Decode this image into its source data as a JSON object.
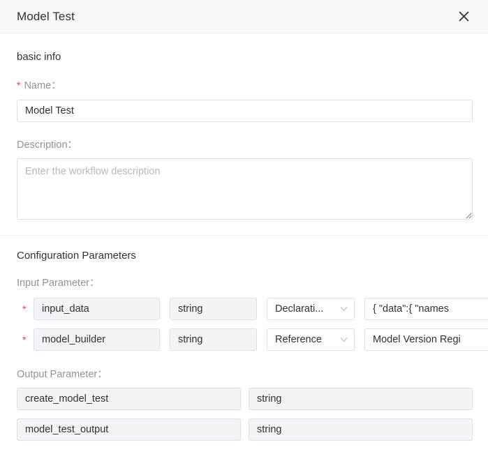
{
  "header": {
    "title": "Model Test",
    "close_label": "×"
  },
  "basic_info": {
    "section_title": "basic info",
    "name_label": "Name：",
    "name_required_mark": "*",
    "name_value": "Model Test",
    "description_label": "Description：",
    "description_value": "",
    "description_placeholder": "Enter the workflow description"
  },
  "configuration": {
    "section_title": "Configuration Parameters",
    "input_label": "Input Parameter：",
    "output_label": "Output Parameter：",
    "input_parameters": [
      {
        "required_mark": "*",
        "name": "input_data",
        "type": "string",
        "source": "Declarati...",
        "value": "{   \"data\":{    \"names"
      },
      {
        "required_mark": "*",
        "name": "model_builder",
        "type": "string",
        "source": "Reference",
        "value": "Model Version Regi"
      }
    ],
    "output_parameters": [
      {
        "name": "create_model_test",
        "type": "string"
      },
      {
        "name": "model_test_output",
        "type": "string"
      }
    ]
  },
  "colors": {
    "header_bg": "#f8f9fb",
    "required_red": "#f03e3e",
    "label_gray": "#909399",
    "text": "#303133",
    "border": "#dcdfe6",
    "disabled_bg": "#f4f4f8"
  }
}
